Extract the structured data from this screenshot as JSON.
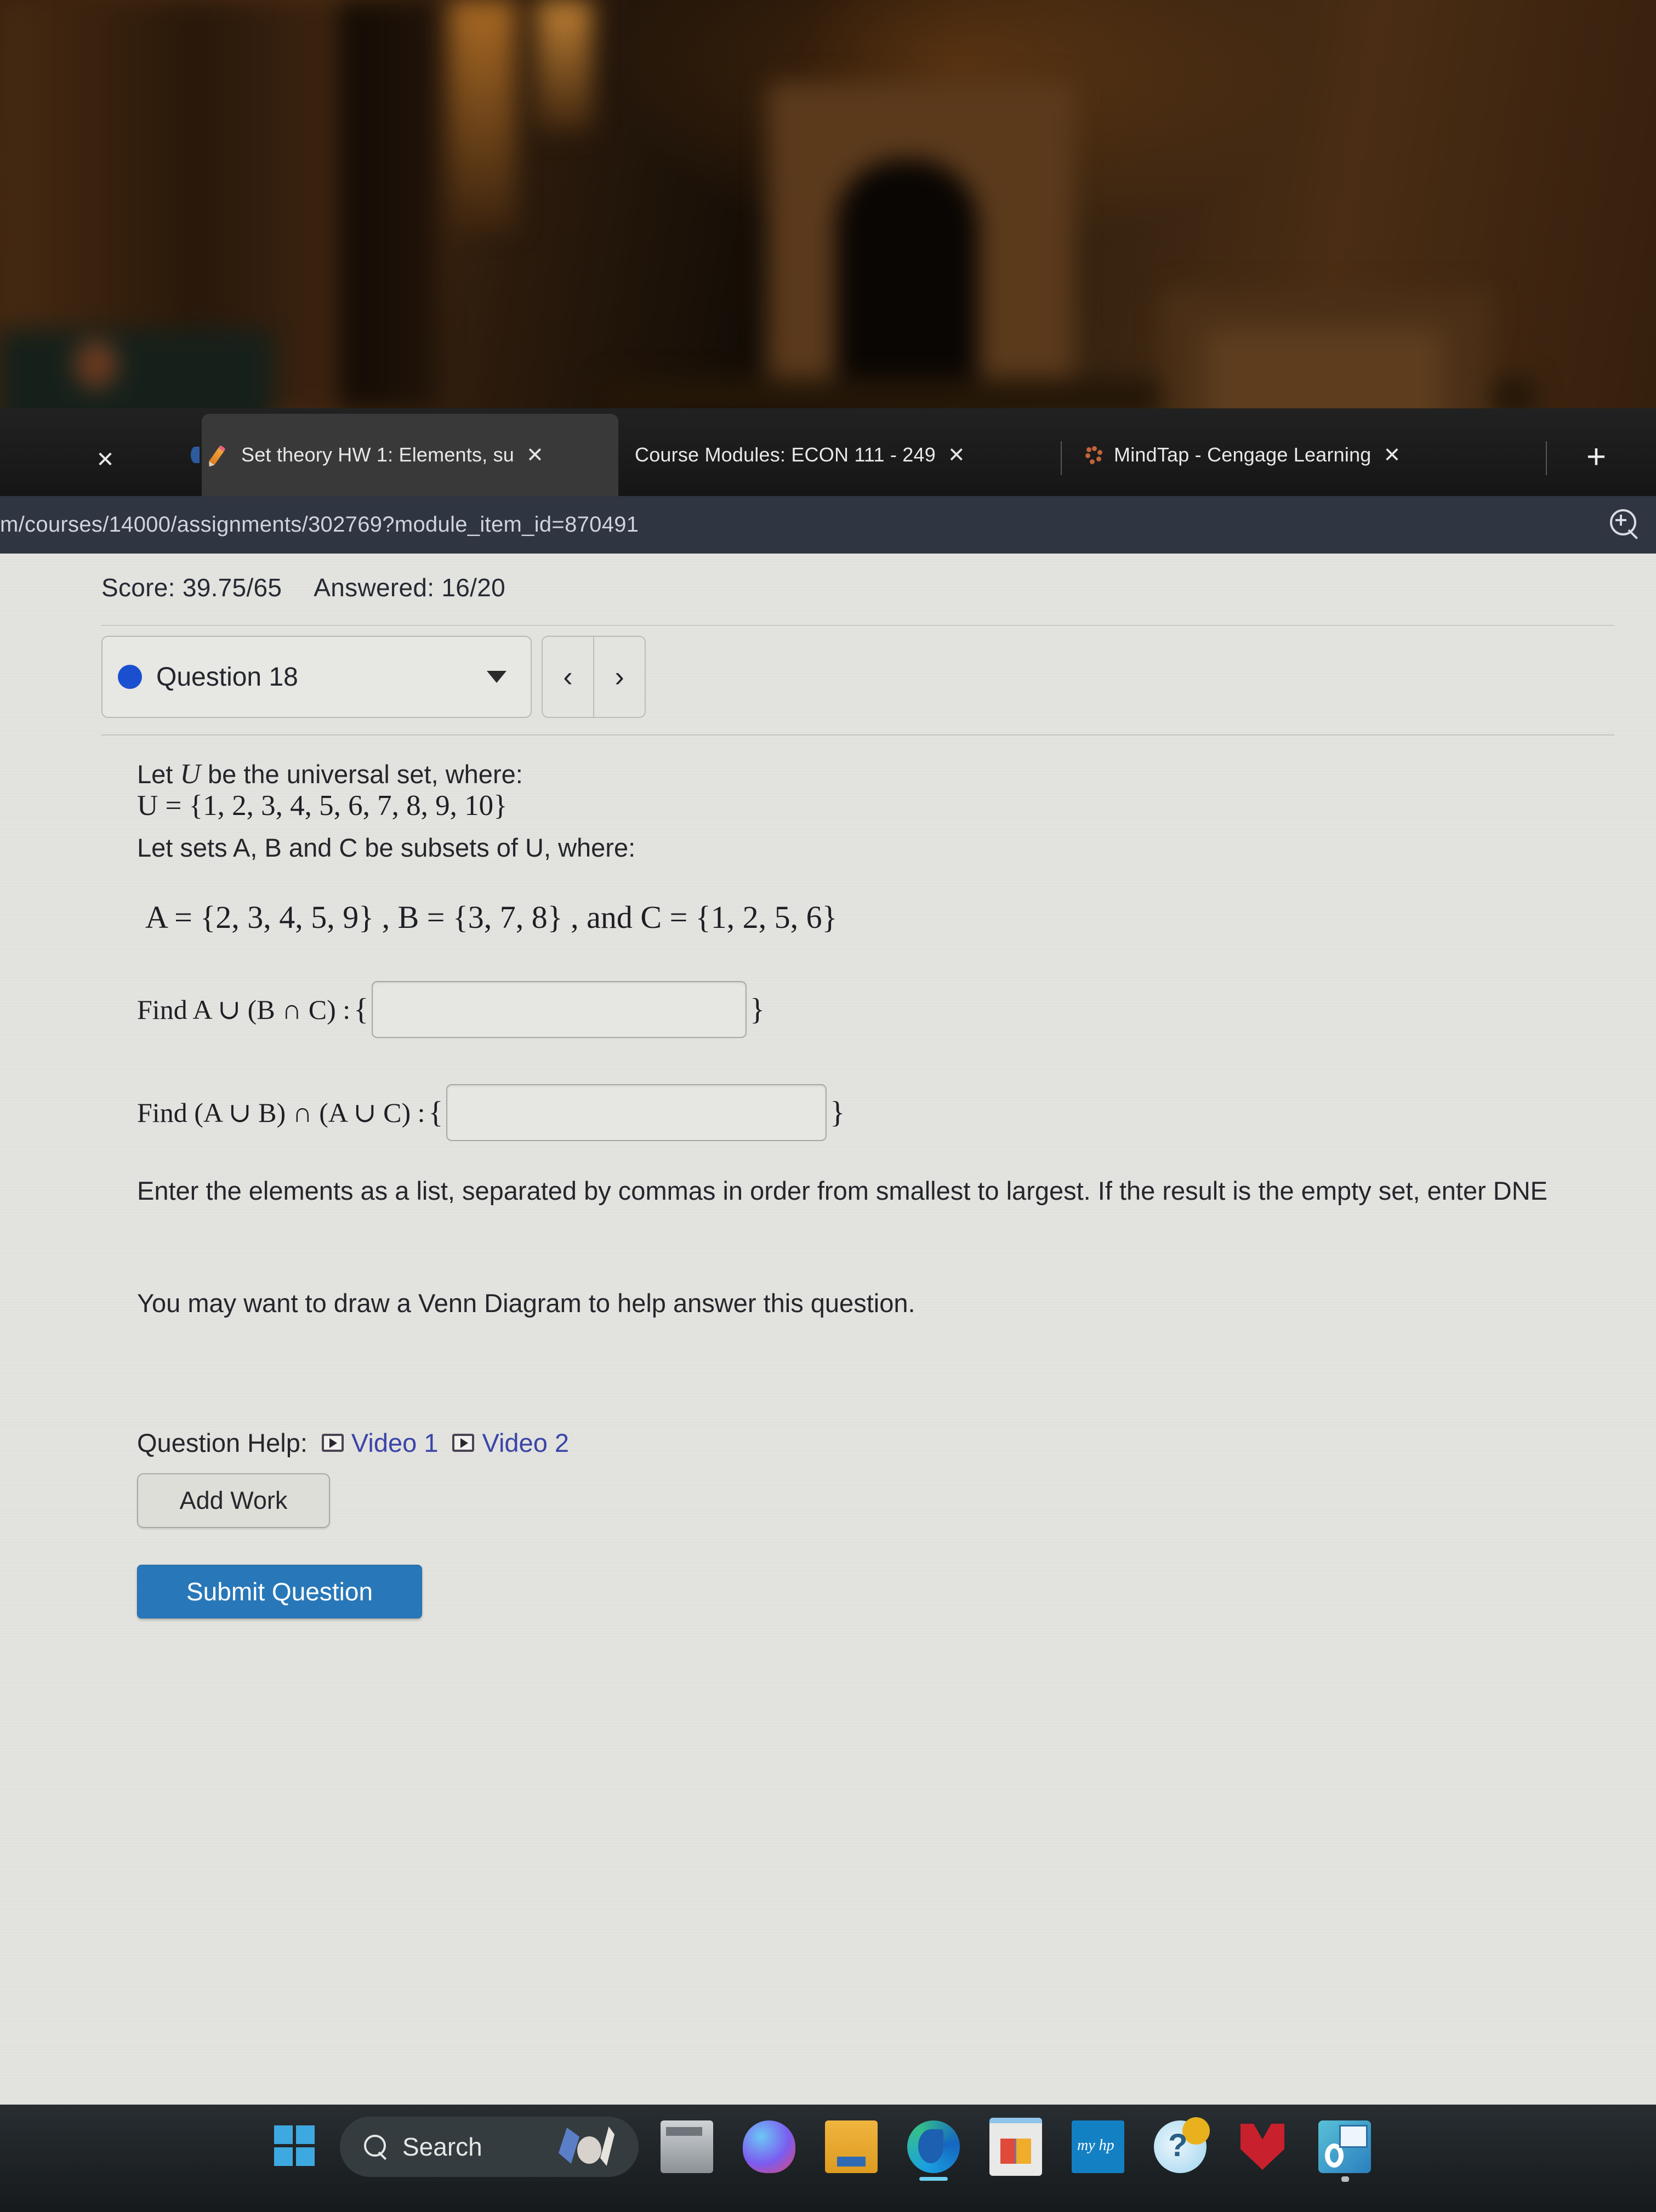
{
  "browser": {
    "tabs": [
      {
        "title": "Set theory HW 1: Elements, su",
        "favicon": "pencil-icon",
        "active": true,
        "close_glyph": "✕"
      },
      {
        "title": "Course Modules: ECON 111 - 249",
        "favicon": "none",
        "active": false,
        "close_glyph": "✕"
      },
      {
        "title": "MindTap - Cengage Learning",
        "favicon": "cengage-icon",
        "active": false,
        "close_glyph": "✕"
      }
    ],
    "left_close_glyph": "✕",
    "new_tab_glyph": "+",
    "url": "m/courses/14000/assignments/302769?module_item_id=870491",
    "zoom_icon": "magnifier-plus-icon"
  },
  "assignment": {
    "score_label": "Score: 39.75/65",
    "answered_label": "Answered: 16/20",
    "question_selector": {
      "label": "Question 18",
      "status_dot_color": "#1a4fd0",
      "caret": "▼"
    },
    "prev_glyph": "‹",
    "next_glyph": "›"
  },
  "question": {
    "line1_pre": "Let ",
    "line1_var": "U",
    "line1_post": " be the universal set, where:",
    "universal_set": "U = {1, 2, 3, 4, 5, 6, 7, 8, 9, 10}",
    "line3": "Let sets A, B and C be subsets of U, where:",
    "sets_line": "A = {2, 3, 4, 5, 9} , B = {3, 7, 8} , and C = {1, 2, 5, 6}",
    "find1_label": "Find A ∪ (B ∩ C) :",
    "find1_value": "",
    "find2_label": "Find (A ∪ B) ∩ (A ∪ C) :",
    "find2_value": "",
    "brace_open": "{",
    "brace_close": "}",
    "instructions": "Enter the elements as a list, separated by commas in order from smallest to largest. If the result is the empty set, enter DNE",
    "hint": "You may want to draw a Venn Diagram to help answer this question.",
    "help_label": "Question Help:",
    "help_links": [
      {
        "label": "Video 1",
        "icon": "video-play-icon"
      },
      {
        "label": "Video 2",
        "icon": "video-play-icon"
      }
    ],
    "add_work_label": "Add Work",
    "submit_label": "Submit Question",
    "link_color": "#3a44a8",
    "submit_color": "#2878b9"
  },
  "taskbar": {
    "start_icon": "windows-start-icon",
    "search_placeholder": "Search",
    "search_icon": "search-icon",
    "apps": [
      {
        "name": "file-explorer-icon"
      },
      {
        "name": "teams-icon"
      },
      {
        "name": "folder-icon"
      },
      {
        "name": "edge-icon"
      },
      {
        "name": "microsoft-store-icon"
      },
      {
        "name": "my-hp-icon"
      },
      {
        "name": "help-icon"
      },
      {
        "name": "mcafee-icon"
      },
      {
        "name": "outlook-icon"
      }
    ]
  }
}
